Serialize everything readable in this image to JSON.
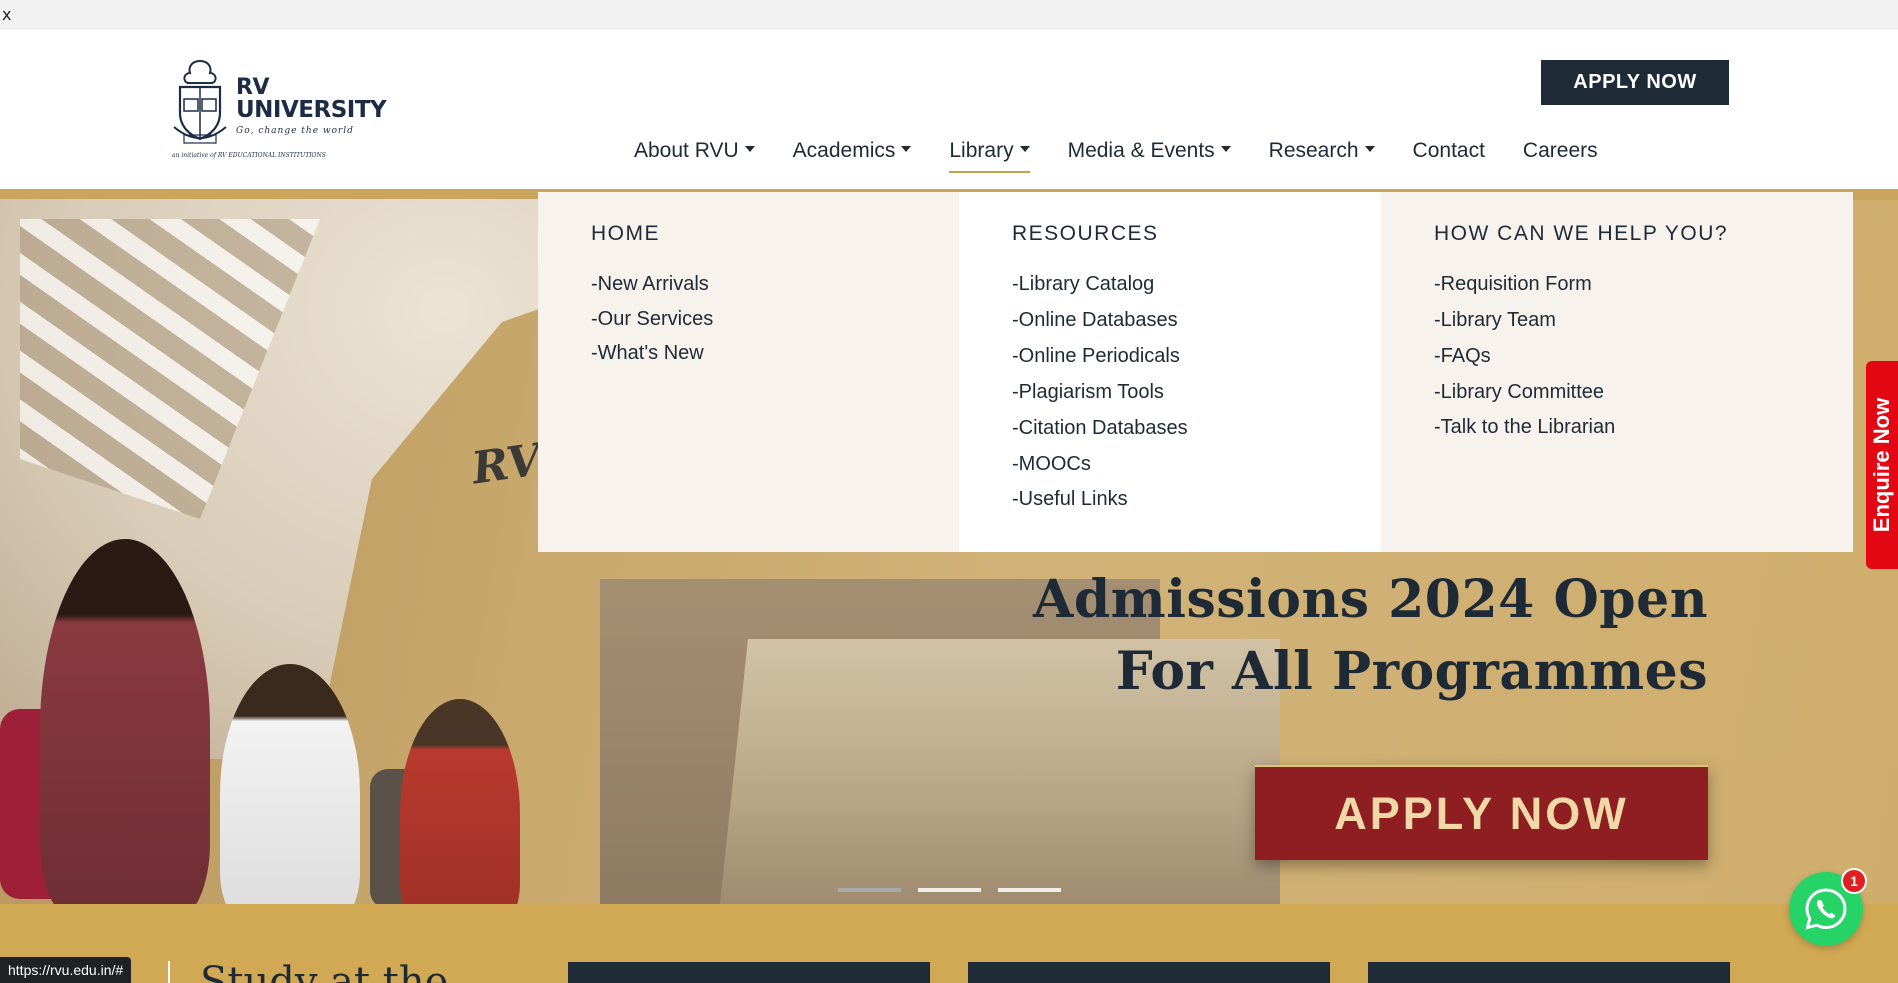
{
  "topbar": {
    "close_label": "x"
  },
  "logo": {
    "line1": "RV",
    "line2": "UNIVERSITY",
    "tagline": "Go, change the world",
    "initiative": "an initiative of RV EDUCATIONAL INSTITUTIONS"
  },
  "header": {
    "apply_label": "APPLY NOW",
    "nav": [
      {
        "label": "About RVU",
        "dropdown": true
      },
      {
        "label": "Academics",
        "dropdown": true
      },
      {
        "label": "Library",
        "dropdown": true,
        "active": true
      },
      {
        "label": "Media & Events",
        "dropdown": true
      },
      {
        "label": "Research",
        "dropdown": true
      },
      {
        "label": "Contact",
        "dropdown": false
      },
      {
        "label": "Careers",
        "dropdown": false
      }
    ]
  },
  "mega_menu": {
    "columns": [
      {
        "heading": "HOME",
        "links": [
          "-New Arrivals",
          "-Our Services",
          "-What's New"
        ]
      },
      {
        "heading": "RESOURCES",
        "links": [
          "-Library Catalog",
          "-Online Databases",
          "-Online Periodicals",
          "-Plagiarism Tools",
          "-Citation Databases",
          "-MOOCs",
          "-Useful Links"
        ]
      },
      {
        "heading": "HOW CAN WE HELP YOU?",
        "links": [
          "-Requisition Form",
          "-Library Team",
          "-FAQs",
          "-Library Committee",
          "-Talk to the Librarian"
        ]
      }
    ]
  },
  "hero": {
    "sign": "RV",
    "headline_line1": "Admissions 2024 Open",
    "headline_line2": "For All Programmes",
    "apply_label": "APPLY NOW",
    "slide_count": 3,
    "active_slide": 1
  },
  "enquire": {
    "label": "Enquire Now",
    "color": "#e30613"
  },
  "whatsapp": {
    "badge": "1",
    "color": "#25d366"
  },
  "bottom": {
    "section_title": "Study at the"
  },
  "status_bar": {
    "url": "https://rvu.edu.in/#"
  },
  "colors": {
    "navy": "#1e2a35",
    "gold": "#d1a954",
    "maroon": "#8f1e22",
    "accent_underline": "#c9a14a"
  }
}
